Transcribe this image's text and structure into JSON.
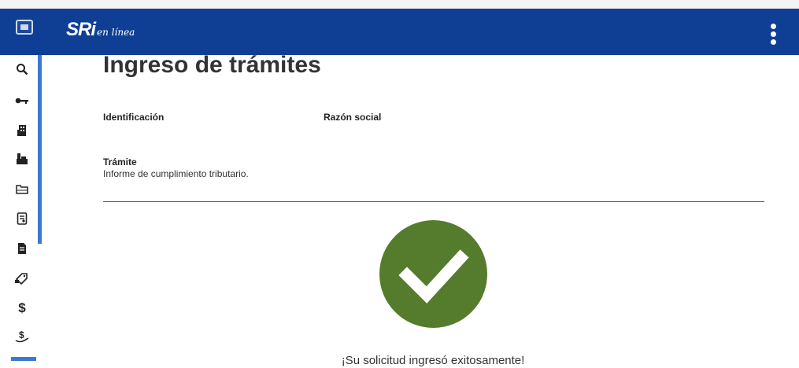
{
  "header": {
    "logo_main": "SRi",
    "logo_sub": "en línea"
  },
  "sidebar": {
    "items": [
      {
        "icon": "search-icon"
      },
      {
        "icon": "key-icon"
      },
      {
        "icon": "building-icon"
      },
      {
        "icon": "factory-icon"
      },
      {
        "icon": "folder-icon"
      },
      {
        "icon": "document-search-icon"
      },
      {
        "icon": "document-icon"
      },
      {
        "icon": "tag-icon"
      },
      {
        "icon": "dollar-icon"
      },
      {
        "icon": "dollar-hand-icon"
      }
    ]
  },
  "main": {
    "title": "Ingreso de trámites",
    "identificacion_label": "Identificación",
    "razon_social_label": "Razón social",
    "tramite_label": "Trámite",
    "tramite_value": "Informe de cumplimiento tributario.",
    "success_message": "¡Su solicitud ingresó exitosamente!"
  },
  "colors": {
    "header_bg": "#0e3f94",
    "sidebar_accent": "#3a79d2",
    "success_green": "#557b2c"
  }
}
